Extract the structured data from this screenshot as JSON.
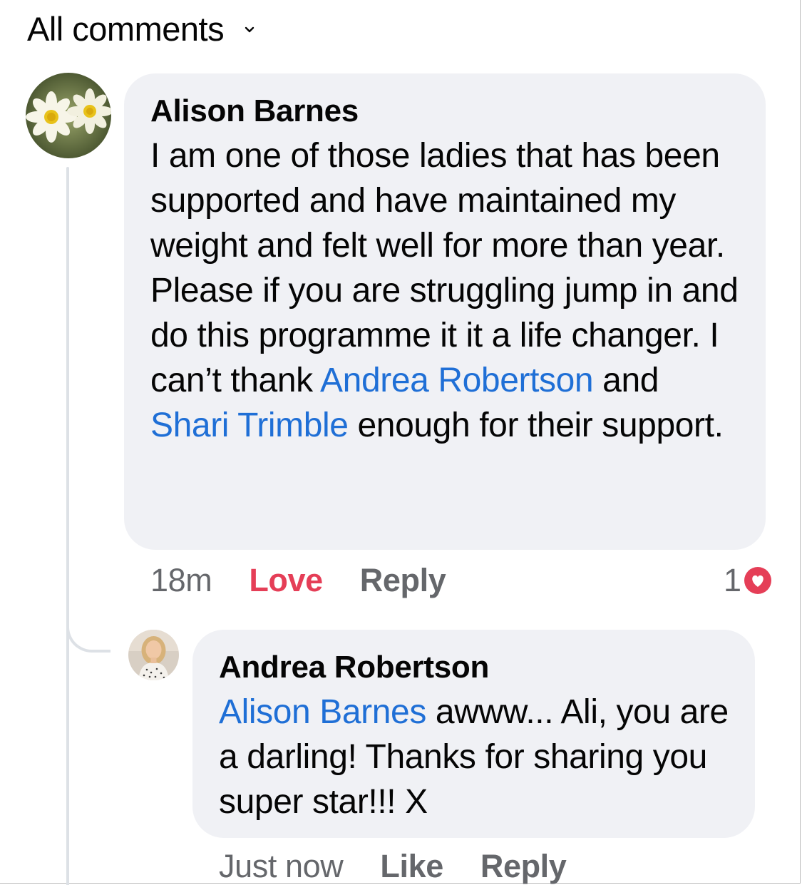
{
  "header": {
    "title": "All comments",
    "chevron_icon": "chevron-down-icon"
  },
  "comments": [
    {
      "author": "Alison Barnes",
      "avatar_icon": "daisy-flowers-avatar",
      "text_before": "I am one of those ladies that has been supported and have maintained my weight and felt well for more than year. Please if you are struggling jump in and do this programme it it a life changer. I can’t thank ",
      "mention_1": "Andrea Robertson",
      "text_mid": " and ",
      "mention_2": "Shari Trimble",
      "text_after": " enough for their support.",
      "time": "18m",
      "primary_action": "Love",
      "reply_label": "Reply",
      "reaction_count": "1",
      "reaction_icon": "love-heart-icon",
      "reaction_color": "#e53e57"
    }
  ],
  "replies": [
    {
      "author": "Andrea Robertson",
      "avatar_icon": "profile-photo-avatar",
      "mention": "Alison Barnes",
      "text": " awww... Ali, you are a darling! Thanks for sharing you super star!!! X",
      "time": "Just now",
      "primary_action": "Like",
      "reply_label": "Reply"
    }
  ],
  "colors": {
    "bubble_bg": "#f0f1f5",
    "mention": "#1f6fd6",
    "love": "#e53e57",
    "secondary_text": "#65676b"
  }
}
